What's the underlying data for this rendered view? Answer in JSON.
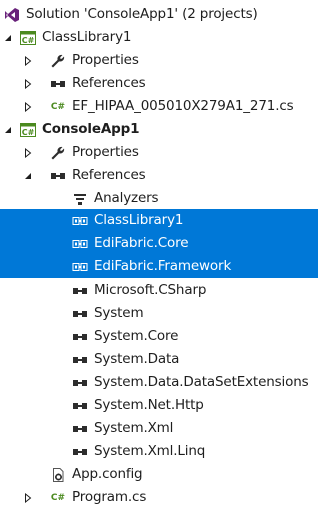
{
  "tree": {
    "solution_label": "Solution 'ConsoleApp1' (2 projects)",
    "classlibrary": {
      "label": "ClassLibrary1",
      "properties": "Properties",
      "references": "References",
      "file": "EF_HIPAA_005010X279A1_271.cs"
    },
    "consoleapp": {
      "label": "ConsoleApp1",
      "properties": "Properties",
      "references": "References",
      "ref_items": [
        "Analyzers",
        "ClassLibrary1",
        "EdiFabric.Core",
        "EdiFabric.Framework",
        "Microsoft.CSharp",
        "System",
        "System.Core",
        "System.Data",
        "System.Data.DataSetExtensions",
        "System.Net.Http",
        "System.Xml",
        "System.Xml.Linq"
      ],
      "config": "App.config",
      "program": "Program.cs"
    }
  },
  "icons": {
    "csharp_glyph": "C#",
    "solution": "visual-studio-solution-icon",
    "project": "csharp-project-icon",
    "properties": "wrench-icon",
    "references": "references-icon",
    "analyzers": "analyzers-icon",
    "project_reference": "project-reference-icon",
    "assembly_reference": "assembly-reference-icon",
    "config": "config-file-icon"
  },
  "colors": {
    "selection": "#0078d7",
    "csharp_green": "#4b8a1f",
    "solution_purple": "#68217a"
  }
}
